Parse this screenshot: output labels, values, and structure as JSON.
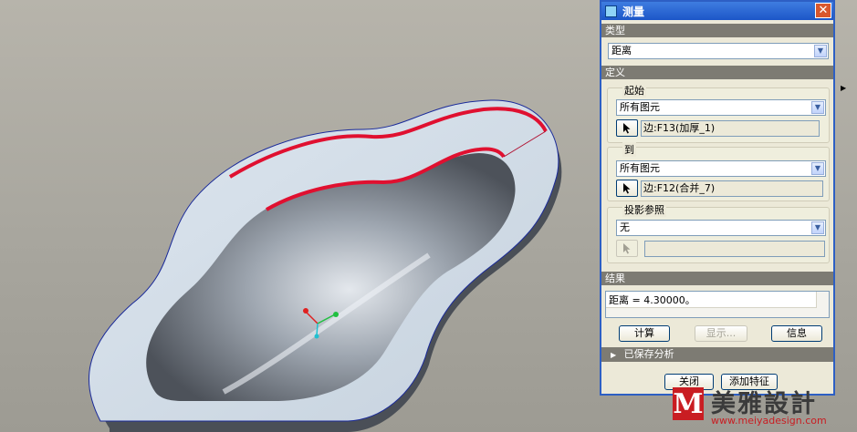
{
  "dialog": {
    "title": "测量",
    "close_label": "✕",
    "type_section": "类型",
    "type_value": "距离",
    "definition_section": "定义",
    "from": {
      "group_label": "起始",
      "filter_value": "所有图元",
      "selection": "边:F13(加厚_1)"
    },
    "to": {
      "group_label": "到",
      "filter_value": "所有图元",
      "selection": "边:F12(合并_7)"
    },
    "projection": {
      "group_label": "投影参照",
      "filter_value": "无",
      "selection": ""
    },
    "result_section": "结果",
    "result_text": "距离  =  4.30000。",
    "buttons": {
      "compute": "计算",
      "display": "显示...",
      "info": "信息",
      "close": "关闭",
      "add_feature": "添加特征"
    },
    "saved_analysis": "已保存分析"
  },
  "watermark": {
    "logo_letter": "M",
    "name": "美雅設計",
    "url": "www.meiyadesign.com"
  },
  "colors": {
    "titlebar": "#1c56c8",
    "measure_highlight": "#e01030",
    "part_surface": "#d3dde8",
    "background": "#aba89f"
  }
}
